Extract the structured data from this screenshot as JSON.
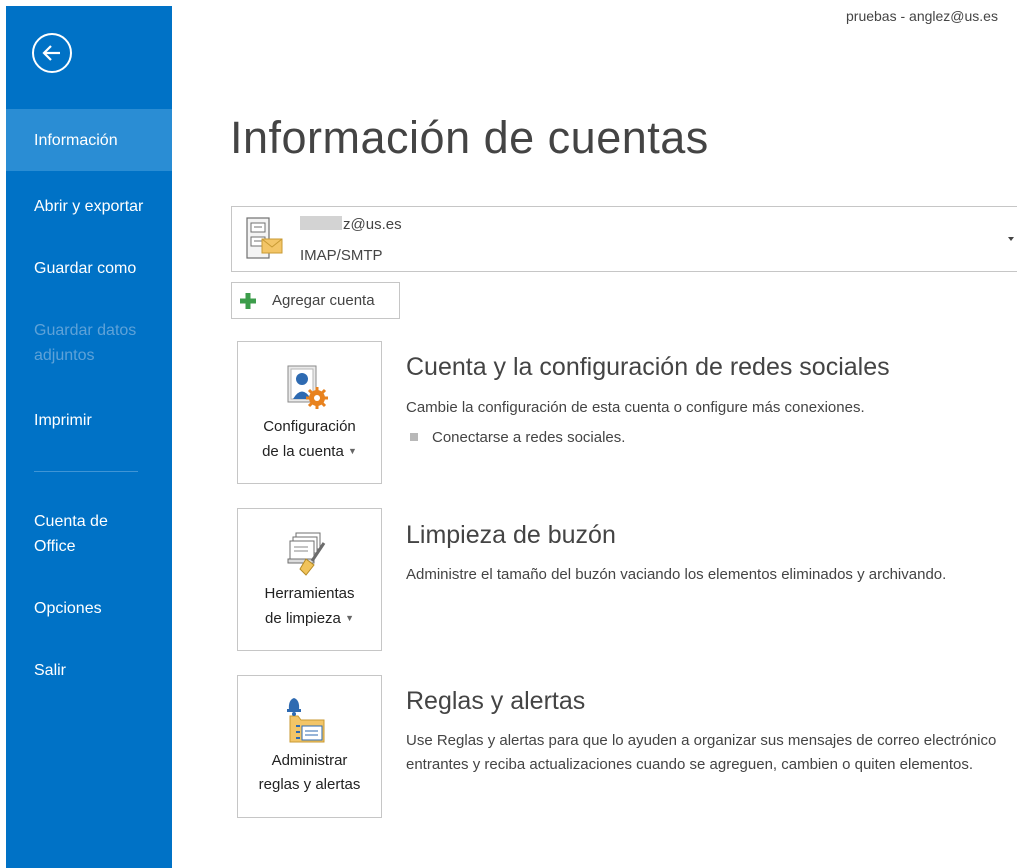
{
  "user": "pruebas - anglez@us.es",
  "sidebar": {
    "items": [
      {
        "label": "Información"
      },
      {
        "label": "Abrir y exportar"
      },
      {
        "label": "Guardar como"
      },
      {
        "label": "Guardar datos adjuntos"
      },
      {
        "label": "Imprimir"
      },
      {
        "label": "Cuenta de Office"
      },
      {
        "label": "Opciones"
      },
      {
        "label": "Salir"
      }
    ]
  },
  "main": {
    "title": "Información de cuentas",
    "account": {
      "email": "z@us.es",
      "type": "IMAP/SMTP"
    },
    "add_account_label": "Agregar cuenta",
    "sections": [
      {
        "tile_line1": "Configuración",
        "tile_line2": "de la cuenta",
        "heading": "Cuenta y la configuración de redes sociales",
        "description": "Cambie la configuración de esta cuenta o configure más conexiones.",
        "bullet": "Conectarse a redes sociales."
      },
      {
        "tile_line1": "Herramientas",
        "tile_line2": "de limpieza",
        "heading": "Limpieza de buzón",
        "description": "Administre el tamaño del buzón vaciando los elementos eliminados y archivando."
      },
      {
        "tile_line1": "Administrar",
        "tile_line2": "reglas y alertas",
        "heading": "Reglas y alertas",
        "description": "Use Reglas y alertas para que lo ayuden a organizar sus mensajes de correo electrónico entrantes y reciba actualizaciones cuando se agreguen, cambien o quiten elementos."
      }
    ]
  },
  "colors": {
    "sidebar": "#0072c6",
    "sidebar_active": "#2a8dd4",
    "sidebar_disabled_text": "#5ea2d8",
    "text": "#444444",
    "border": "#c6c6c6",
    "plus_green": "#3c9d4b"
  },
  "icons": {
    "back": "back-arrow-circle-icon",
    "account": "account-server-mail-icon",
    "add": "plus-icon",
    "account_settings": "account-settings-person-gear-icon",
    "cleanup": "mailbox-cleanup-broom-icon",
    "rules": "rules-alerts-bell-folder-icon",
    "dropdown": "chevron-down-icon"
  }
}
